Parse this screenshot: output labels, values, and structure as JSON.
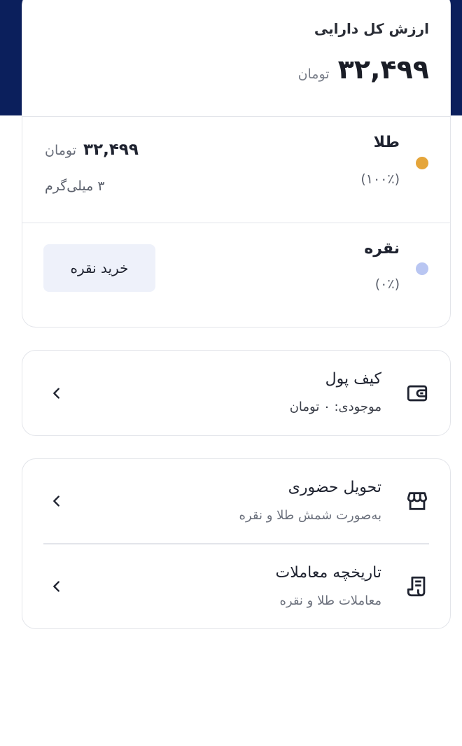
{
  "total": {
    "title": "ارزش کل دارایی",
    "amount": "۳۲,۴۹۹",
    "unit": "تومان"
  },
  "gold": {
    "name": "طلا",
    "percent": "(۱۰۰٪)",
    "amount": "۳۲,۴۹۹",
    "unit": "تومان",
    "weight": "۳ میلی‌گرم",
    "color": "#e5a53a"
  },
  "silver": {
    "name": "نقره",
    "percent": "(۰٪)",
    "buy_label": "خرید نقره",
    "color": "#b9c6f2"
  },
  "wallet": {
    "title": "کیف پول",
    "balance": "موجودی: ۰ تومان",
    "icon": "wallet-icon"
  },
  "services": [
    {
      "title": "تحویل حضوری",
      "subtitle": "به‌صورت شمش طلا و نقره",
      "icon": "store-icon"
    },
    {
      "title": "تاریخچه معاملات",
      "subtitle": "معاملات طلا و نقره",
      "icon": "receipt-icon"
    }
  ],
  "theme": {
    "header_bg": "#0b1f5c",
    "card_border": "#e3e5ea"
  }
}
